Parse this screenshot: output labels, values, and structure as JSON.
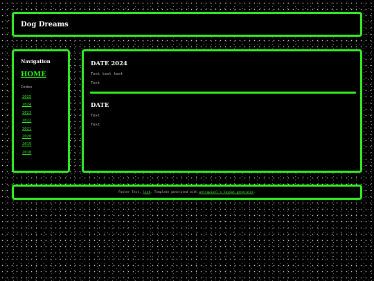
{
  "header": {
    "title": "Dog Dreams"
  },
  "sidebar": {
    "heading": "Navigation",
    "home_link": "HOME",
    "index_label": "Index",
    "years": [
      "2025",
      "2024",
      "2023",
      "2022",
      "2021",
      "2020",
      "2019",
      "2018"
    ]
  },
  "main": {
    "posts": [
      {
        "title": "DATE 2024",
        "lines": [
          "Text text text",
          "Text"
        ]
      },
      {
        "title": "DATE",
        "lines": [
          "Text",
          "Text"
        ]
      }
    ]
  },
  "footer": {
    "prefix": "Footer Text, ",
    "link1": "link",
    "middle": ". Template generated with ",
    "link2": "petrapixel's layout generator",
    "suffix": "."
  },
  "colors": {
    "accent": "#33ee22",
    "background": "#000000",
    "text": "#ffffff",
    "muted_text": "#bbbbbb"
  }
}
